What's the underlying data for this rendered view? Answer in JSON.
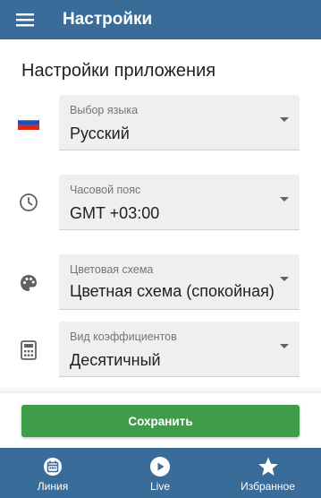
{
  "appbar": {
    "title": "Настройки",
    "menu_icon": "hamburger-menu-icon"
  },
  "section": {
    "title": "Настройки приложения"
  },
  "settings": [
    {
      "icon": "russia-flag-icon",
      "label": "Выбор языка",
      "value": "Русский"
    },
    {
      "icon": "clock-icon",
      "label": "Часовой пояс",
      "value": "GMT +03:00"
    },
    {
      "icon": "palette-icon",
      "label": "Цветовая схема",
      "value": "Цветная схема (спокойная)"
    },
    {
      "icon": "calculator-icon",
      "label": "Вид коэффициентов",
      "value": "Десятичный"
    }
  ],
  "save": {
    "label": "Сохранить"
  },
  "bottom_nav": {
    "items": [
      {
        "icon": "calendar-icon",
        "label": "Линия"
      },
      {
        "icon": "play-icon",
        "label": "Live"
      },
      {
        "icon": "star-icon",
        "label": "Избранное"
      }
    ]
  },
  "colors": {
    "primary": "#3a6c9a",
    "save_button": "#3f9d4a",
    "field_background": "#efefef"
  }
}
